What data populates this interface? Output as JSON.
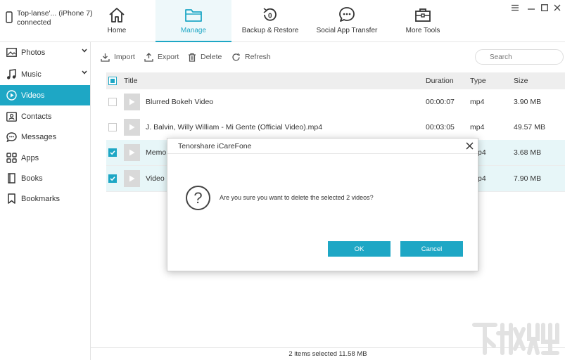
{
  "device": {
    "name": "Top-lanse'... (iPhone 7)",
    "status": "connected"
  },
  "nav": {
    "items": [
      {
        "label": "Home",
        "icon": "home-icon"
      },
      {
        "label": "Manage",
        "icon": "folder-icon"
      },
      {
        "label": "Backup & Restore",
        "icon": "backup-restore-icon"
      },
      {
        "label": "Social App Transfer",
        "icon": "chat-bubble-icon"
      },
      {
        "label": "More Tools",
        "icon": "toolbox-icon"
      }
    ]
  },
  "sidebar": {
    "items": [
      {
        "label": "Photos",
        "icon": "photos-icon"
      },
      {
        "label": "Music",
        "icon": "music-note-icon"
      },
      {
        "label": "Videos",
        "icon": "play-circle-icon"
      },
      {
        "label": "Contacts",
        "icon": "contacts-icon"
      },
      {
        "label": "Messages",
        "icon": "messages-icon"
      },
      {
        "label": "Apps",
        "icon": "apps-grid-icon"
      },
      {
        "label": "Books",
        "icon": "book-icon"
      },
      {
        "label": "Bookmarks",
        "icon": "bookmark-icon"
      }
    ]
  },
  "toolbar": {
    "import_label": "Import",
    "export_label": "Export",
    "delete_label": "Delete",
    "refresh_label": "Refresh",
    "search_placeholder": "Search"
  },
  "table": {
    "columns": [
      "Title",
      "Duration",
      "Type",
      "Size"
    ],
    "rows": [
      {
        "title": "Blurred Bokeh Video",
        "duration": "00:00:07",
        "type": "mp4",
        "size": "3.90 MB",
        "checked": false
      },
      {
        "title": "J. Balvin, Willy William - Mi Gente (Official Video).mp4",
        "duration": "00:03:05",
        "type": "mp4",
        "size": "49.57 MB",
        "checked": false
      },
      {
        "title": "Memo",
        "duration": "",
        "type": "p4",
        "size": "3.68 MB",
        "checked": true
      },
      {
        "title": "Video (",
        "duration": "",
        "type": "p4",
        "size": "7.90 MB",
        "checked": true
      }
    ]
  },
  "status": {
    "text": "2 items selected 11.58 MB"
  },
  "dialog": {
    "title": "Tenorshare iCareFone",
    "message": "Are you sure you want to delete the selected 2 videos?",
    "ok_label": "OK",
    "cancel_label": "Cancel"
  },
  "colors": {
    "accent": "#1ea7c5",
    "selected_row": "#e7f6f8",
    "header_bg": "#eeeeee"
  }
}
